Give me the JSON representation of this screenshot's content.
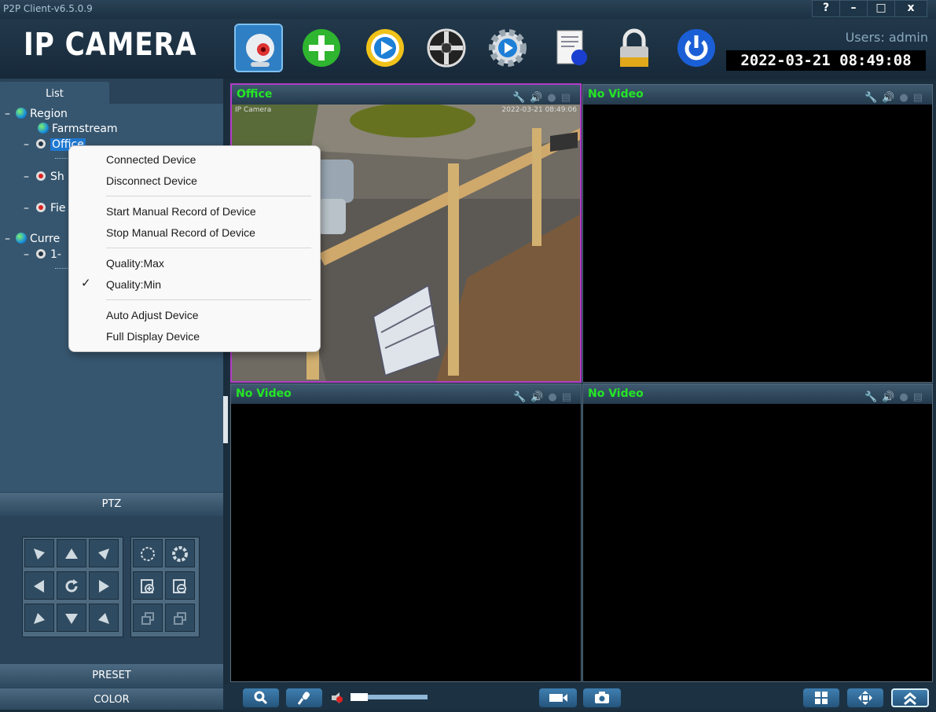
{
  "window": {
    "title": "P2P Client-v6.5.0.9",
    "help": "?",
    "minimize": "–",
    "maximize": "□",
    "close": "x"
  },
  "header": {
    "logo": "IP CAMERA",
    "users": "Users: admin",
    "clock": "2022-03-21  08:49:08",
    "tools": [
      "camera-view",
      "add-device",
      "playback",
      "ptz-control",
      "settings",
      "log",
      "lock",
      "power"
    ]
  },
  "left": {
    "list_tab": "List",
    "tree": {
      "region": "Region",
      "farmstream": "Farmstream",
      "office": "Office",
      "sh": "Sh",
      "fie": "Fie",
      "current": "Curre",
      "one": "1-"
    },
    "ptz": "PTZ",
    "preset": "PRESET",
    "color": "COLOR"
  },
  "video": {
    "cells": [
      {
        "title": "Office",
        "overlay_name": "IP Camera",
        "overlay_time": "2022-03-21 08:49:06"
      },
      {
        "title": "No Video"
      },
      {
        "title": "No Video"
      },
      {
        "title": "No Video"
      }
    ]
  },
  "context_menu": {
    "items": [
      "Connected Device",
      "Disconnect Device",
      "Start Manual Record of Device",
      "Stop Manual Record of Device",
      "Quality:Max",
      "Quality:Min",
      "Auto Adjust Device",
      "Full Display Device"
    ],
    "checked_item": "Quality:Min",
    "check_glyph": "✓"
  },
  "colors": {
    "accent_green": "#25e625",
    "selected_blue": "#1f78d1",
    "active_cell_border": "#b43cc8"
  }
}
